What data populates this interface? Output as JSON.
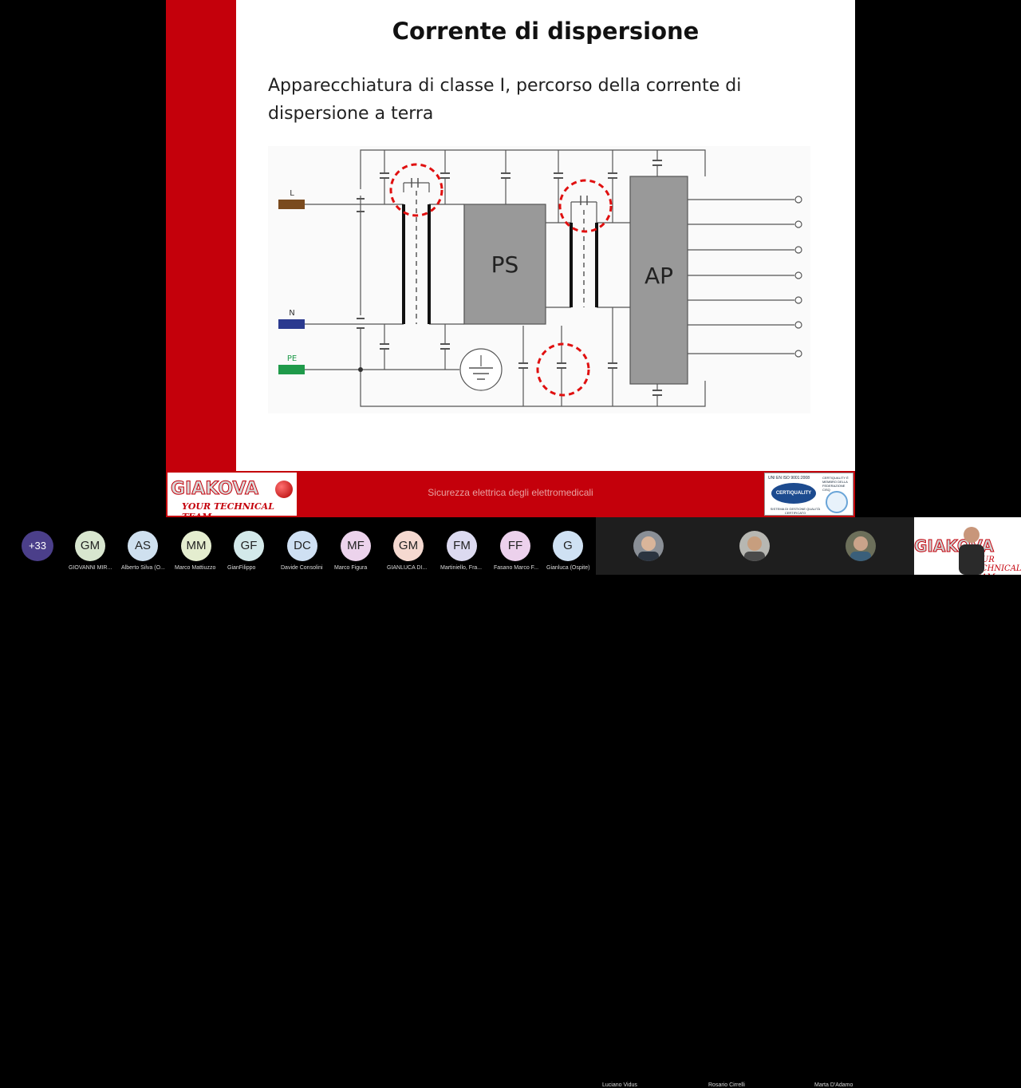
{
  "slide": {
    "title": "Corrente di dispersione",
    "subtitle_line1": "Apparecchiatura  di classe I,  percorso della corrente di",
    "subtitle_line2": "dispersione a terra",
    "footer_caption": "Sicurezza elettrica degli elettromedicali",
    "logo_text": "GIAKOVA",
    "logo_tagline": "YOUR TECHNICAL TEAM",
    "cert_top": "UNI EN ISO 9001:2008",
    "cert_name": "CERTIQUALITY",
    "cert_bottom": "SISTEMA DI GESTIONE QUALITÀ CERTIFICATO",
    "cert_side": "CERTIQUALITY È MEMBRO DELLA FEDERAZIONE CISQ"
  },
  "diagram": {
    "label_l": "L",
    "label_n": "N",
    "label_pe": "PE",
    "block_ps": "PS",
    "block_ap": "AP",
    "color_l": "#7a4a1e",
    "color_n": "#2b3a8f",
    "color_pe": "#1f9a4a",
    "highlight": "#e01010"
  },
  "participants": {
    "more": "+33",
    "list": [
      {
        "initials": "GM",
        "name": "GIOVANNI MIR...",
        "color": "#d8e6cf"
      },
      {
        "initials": "AS",
        "name": "Alberto Silva (O...",
        "color": "#cfe0ef"
      },
      {
        "initials": "MM",
        "name": "Marco Mattiuzzo",
        "color": "#e4edcf"
      },
      {
        "initials": "GF",
        "name": "GianFilippo",
        "color": "#d3e9ea"
      },
      {
        "initials": "DC",
        "name": "Davide Consolini",
        "color": "#cfe0f3"
      },
      {
        "initials": "MF",
        "name": "Marco Figura",
        "color": "#ecd3ec"
      },
      {
        "initials": "GM",
        "name": "GIANLUCA DI...",
        "color": "#f5d9d0"
      },
      {
        "initials": "FM",
        "name": "Martiniello, Fra...",
        "color": "#dcdaf0"
      },
      {
        "initials": "FF",
        "name": "Fasano Marco F...",
        "color": "#ecd1ec"
      },
      {
        "initials": "G",
        "name": "Gianluca (Ospite)",
        "color": "#cfe1f3"
      }
    ]
  },
  "video": [
    {
      "name": "Luciano Vidus"
    },
    {
      "name": "Rosario Cirrelli"
    },
    {
      "name": "Marta D'Adamo"
    }
  ],
  "self_view": {
    "logo_text": "GIAKOVA",
    "tagline": "YOUR TECHNICAL TEAM"
  }
}
